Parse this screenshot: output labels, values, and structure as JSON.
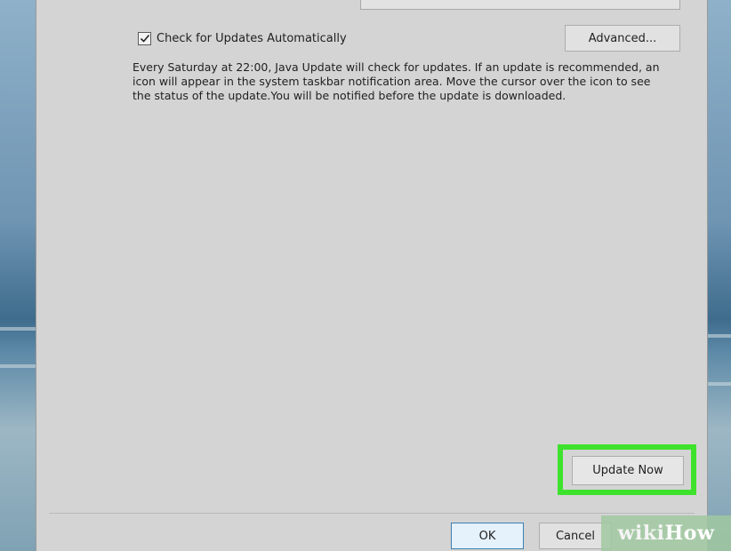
{
  "update_settings": {
    "auto_update_checkbox": {
      "label": "Check for Updates Automatically",
      "checked": true
    },
    "advanced_button": "Advanced...",
    "description": "Every Saturday at 22:00, Java Update will check for updates. If an update is recommended, an icon will appear in the system taskbar notification area. Move the cursor over the icon to see the status of the update.You will be notified before the update is downloaded.",
    "update_now_button": "Update Now"
  },
  "footer": {
    "ok_button": "OK",
    "cancel_button": "Cancel"
  },
  "watermark": {
    "part1": "wiki",
    "part2": "How"
  },
  "colors": {
    "highlight": "#3ee22c",
    "dialog_bg": "#d4d4d4"
  }
}
